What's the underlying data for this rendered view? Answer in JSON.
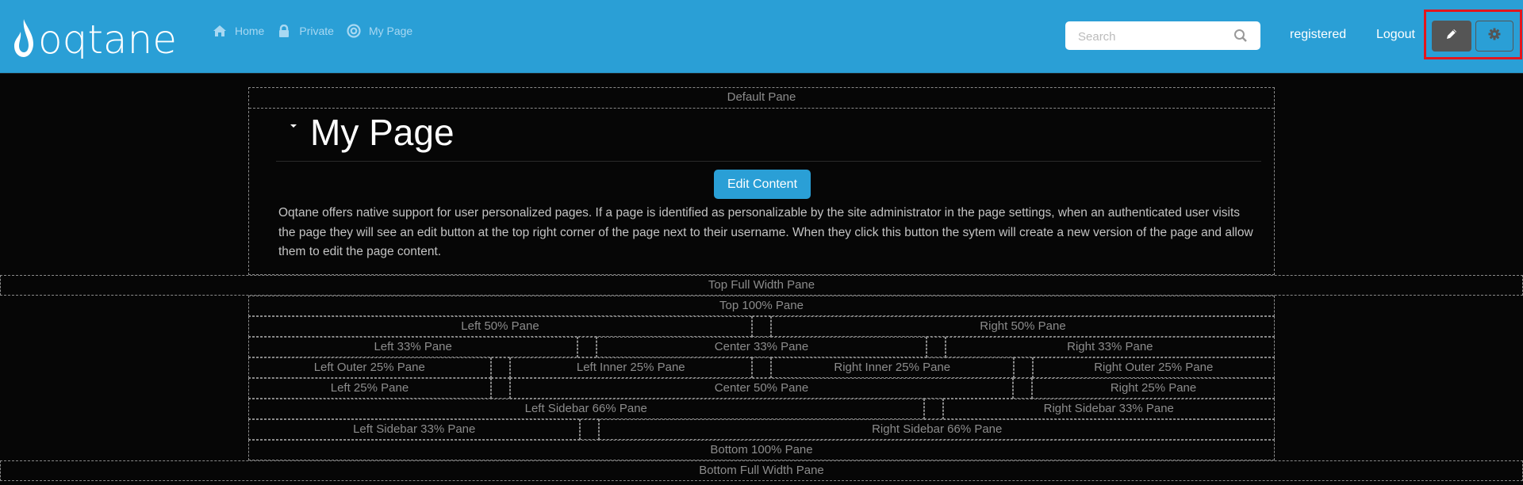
{
  "header": {
    "brand": "oqtane",
    "nav": [
      {
        "label": "Home",
        "icon": "home-icon"
      },
      {
        "label": "Private",
        "icon": "lock-icon"
      },
      {
        "label": "My Page",
        "icon": "target-icon"
      }
    ],
    "search_placeholder": "Search",
    "username": "registered",
    "logout_label": "Logout",
    "edit_button_icon": "pencil-icon",
    "settings_button_icon": "gear-icon"
  },
  "colors": {
    "brand_blue": "#2a9fd6",
    "highlight_red": "#e3161d",
    "edit_button_bg": "#555555",
    "page_bg": "#060606"
  },
  "content": {
    "default_pane": "Default Pane",
    "module_title": "My Page",
    "edit_content_label": "Edit Content",
    "body_text": "Oqtane offers native support for user personalized pages. If a page is identified as personalizable by the site administrator in the page settings, when an authenticated user visits the page they will see an edit button at the top right corner of the page next to their username. When they click this button the sytem will create a new version of the page and allow them to edit the page content."
  },
  "panes": {
    "top_full_width": "Top Full Width Pane",
    "top_100": "Top 100% Pane",
    "left_50": "Left 50% Pane",
    "right_50": "Right 50% Pane",
    "left_33": "Left 33% Pane",
    "center_33": "Center 33% Pane",
    "right_33": "Right 33% Pane",
    "left_outer_25": "Left Outer 25% Pane",
    "left_inner_25": "Left Inner 25% Pane",
    "right_inner_25": "Right Inner 25% Pane",
    "right_outer_25": "Right Outer 25% Pane",
    "left_25": "Left 25% Pane",
    "center_50": "Center 50% Pane",
    "right_25": "Right 25% Pane",
    "left_sidebar_66": "Left Sidebar 66% Pane",
    "right_sidebar_33": "Right Sidebar 33% Pane",
    "left_sidebar_33": "Left Sidebar 33% Pane",
    "right_sidebar_66": "Right Sidebar 66% Pane",
    "bottom_100": "Bottom 100% Pane",
    "bottom_full_width": "Bottom Full Width Pane"
  }
}
